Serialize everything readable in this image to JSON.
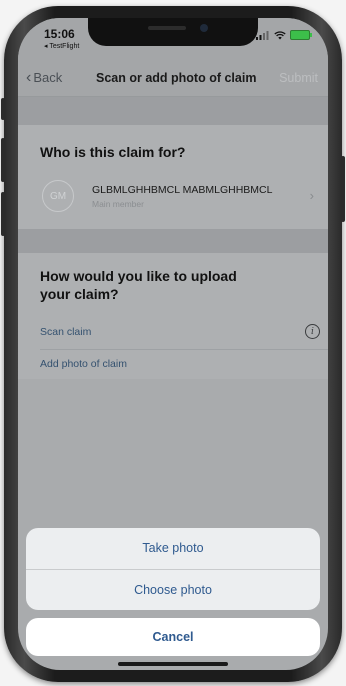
{
  "status_bar": {
    "time": "15:06",
    "back_app": "◂ TestFlight"
  },
  "nav": {
    "back_label": "Back",
    "title": "Scan or add photo of claim",
    "submit_label": "Submit"
  },
  "claim_for": {
    "heading": "Who is this claim for?",
    "member": {
      "initials": "GM",
      "name": "GLBMLGHHBMCL MABMLGHHBMCL",
      "role": "Main member"
    }
  },
  "upload": {
    "heading_line1": "How would you like to upload",
    "heading_line2": "your claim?",
    "options": [
      {
        "label": "Scan claim"
      },
      {
        "label": "Add photo of claim"
      }
    ]
  },
  "action_sheet": {
    "items": [
      {
        "label": "Take photo"
      },
      {
        "label": "Choose photo"
      }
    ],
    "cancel_label": "Cancel"
  },
  "colors": {
    "accent": "#2f5a8f",
    "dim_overlay": "#a9abad",
    "battery": "#3cbf4a"
  },
  "icons": {
    "back": "chevron-left-icon",
    "member_row": "chevron-right-icon",
    "scan_info": "info-icon"
  }
}
